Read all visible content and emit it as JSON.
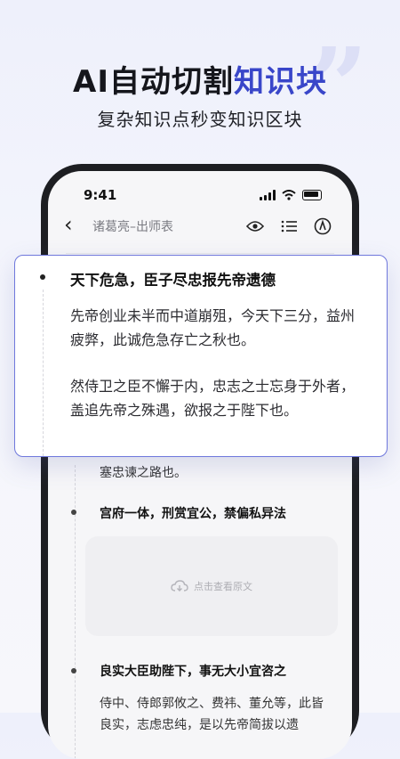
{
  "hero": {
    "title_prefix": "AI自动切割",
    "title_highlight": "知识块",
    "subtitle": "复杂知识点秒变知识区块",
    "quote_mark": "”"
  },
  "status_bar": {
    "time": "9:41"
  },
  "nav": {
    "title": "诸葛亮–出师表"
  },
  "card": {
    "title": "天下危急，臣子尽忠报先帝遗德",
    "paragraph1": "先帝创业未半而中道崩殂，今天下三分，益州疲弊，此诚危急存亡之秋也。",
    "paragraph2": "然侍卫之臣不懈于内，忠志之士忘身于外者，盖追先帝之殊遇，欲报之于陛下也。"
  },
  "content": {
    "tail_text": "塞忠谏之路也。",
    "section2_title": "宫府一体，刑赏宜公，禁偏私异法",
    "locked_label": "点击查看原文",
    "section3_title": "良实大臣助陛下，事无大小宜咨之",
    "section3_text": "侍中、侍郎郭攸之、费祎、董允等，此皆良实，志虑忠纯，是以先帝简拔以遗"
  },
  "colors": {
    "accent": "#3946c9",
    "card_border": "#6f78dc"
  }
}
